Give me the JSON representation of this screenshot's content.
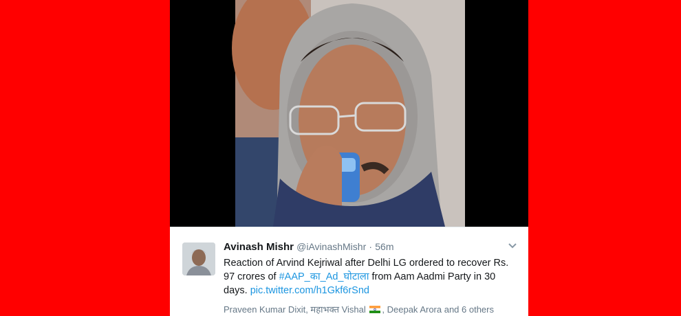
{
  "tweet": {
    "display_name": "Avinash Mishr",
    "handle": "@iAvinashMishr",
    "separator": "·",
    "time": "56m",
    "text_1": "Reaction of Arvind Kejriwal after Delhi LG ordered to recover Rs. 97 crores of ",
    "hashtag": "#AAP_का_Ad_घोटाला",
    "text_2": " from Aam Aadmi Party in 30 days. ",
    "pic_link": "pic.twitter.com/h1Gkf6rSnd",
    "likers_1": "Praveen Kumar Dixit, महाभक्त Vishal ",
    "likers_2": ", Deepak Arora and 6 others"
  },
  "icons": {
    "more": "chevron-down-icon",
    "flag": "india-flag-icon"
  },
  "colors": {
    "background": "#ff0000",
    "link": "#1b95e0",
    "secondary_text": "#657786"
  }
}
